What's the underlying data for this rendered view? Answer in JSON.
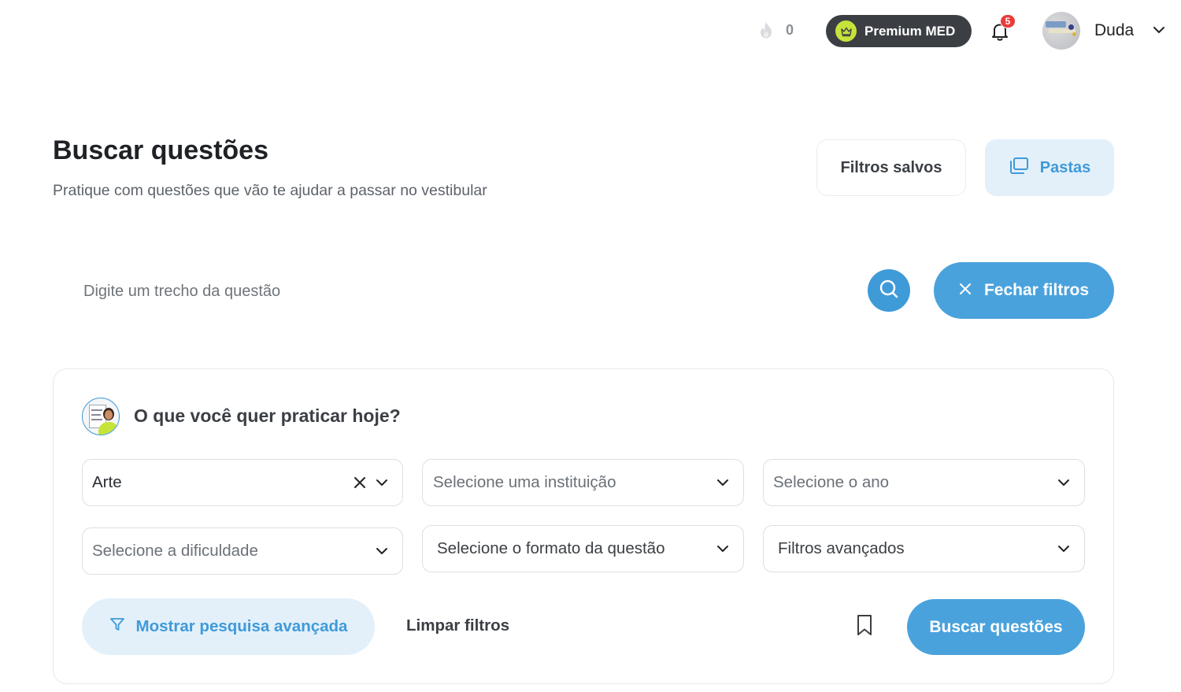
{
  "topbar": {
    "streak_icon": "flame-icon",
    "streak_count": "0",
    "premium_label": "Premium MED",
    "premium_icon": "crown-icon",
    "notifications_count": "5",
    "user_name": "Duda"
  },
  "header": {
    "title": "Buscar questões",
    "subtitle": "Pratique com questões que vão te ajudar a passar no vestibular",
    "saved_filters_label": "Filtros salvos",
    "folders_label": "Pastas"
  },
  "search": {
    "placeholder": "Digite um trecho da questão",
    "close_filters_label": "Fechar filtros"
  },
  "filters": {
    "title": "O que você quer praticar hoje?",
    "subject_value": "Arte",
    "institution_placeholder": "Selecione uma instituição",
    "year_placeholder": "Selecione o ano",
    "difficulty_placeholder": "Selecione a dificuldade",
    "format_placeholder": "Selecione o formato da questão",
    "advanced_placeholder": "Filtros avançados",
    "show_advanced_label": "Mostrar pesquisa avançada",
    "clear_label": "Limpar filtros",
    "submit_label": "Buscar questões"
  },
  "colors": {
    "primary": "#4aa2dc",
    "primary_light": "#e3f0fa",
    "premium_bg": "#3b3f44",
    "premium_badge": "#c6e33a",
    "notification_badge": "#ea3b3b"
  }
}
